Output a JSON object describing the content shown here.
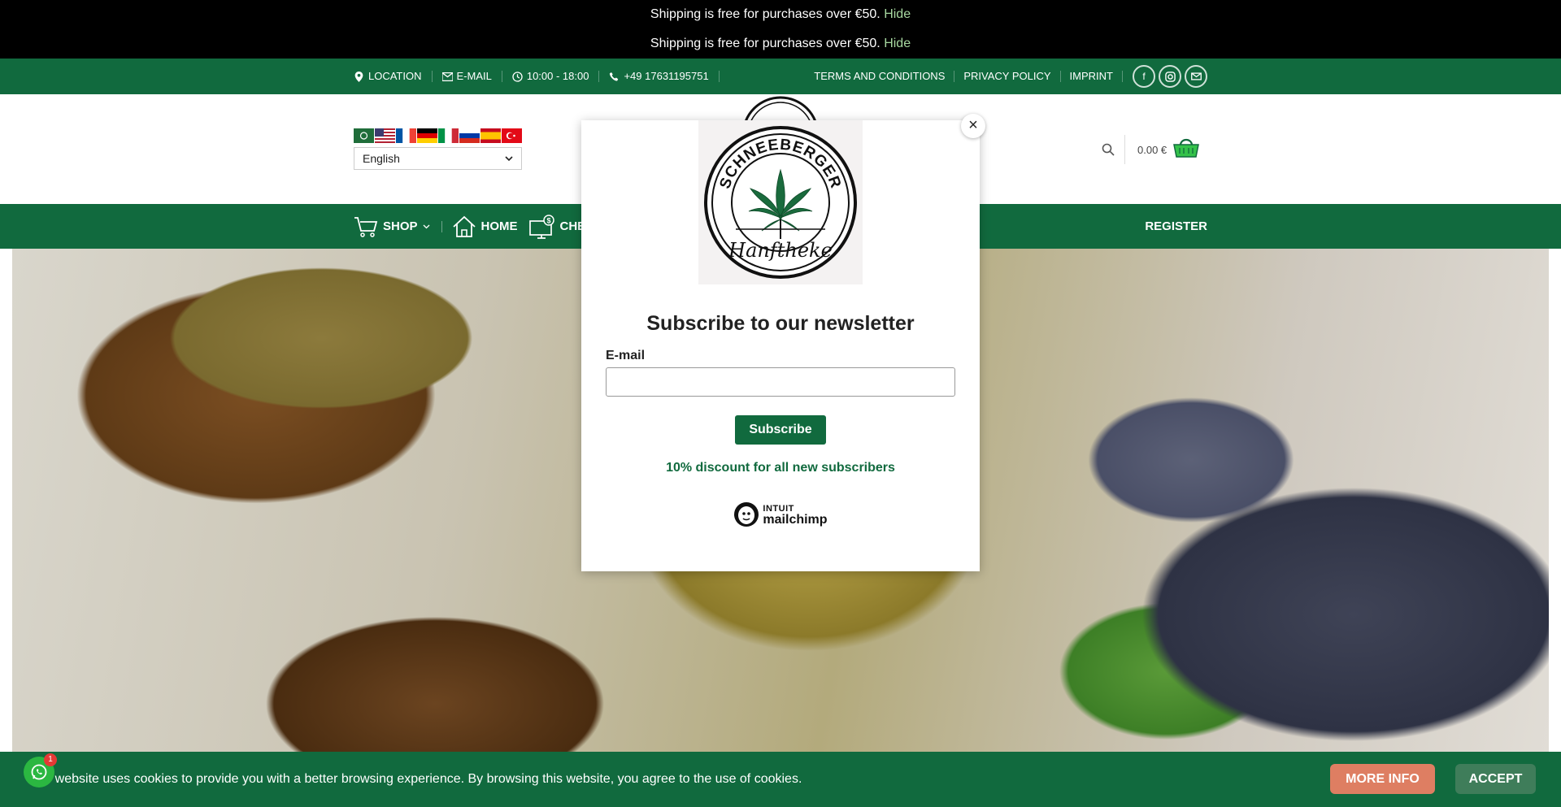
{
  "promo": {
    "lines": [
      {
        "text": "Shipping is free for purchases over €50.",
        "link": "Hide"
      },
      {
        "text": "Shipping is free for purchases over €50.",
        "link": "Hide"
      }
    ]
  },
  "topbar": {
    "location": "LOCATION",
    "email": "E-MAIL",
    "hours": "10:00 - 18:00",
    "phone": "+49 17631195751",
    "links": [
      "TERMS AND CONDITIONS",
      "PRIVACY POLICY",
      "IMPRINT"
    ],
    "social": [
      "facebook-icon",
      "instagram-icon",
      "mail-icon"
    ]
  },
  "header": {
    "language_selected": "English",
    "flags": [
      "ar",
      "en",
      "fr",
      "de",
      "it",
      "ru",
      "es",
      "tr"
    ],
    "cart_total": "0.00 €"
  },
  "nav": {
    "shop": "SHOP",
    "home": "HOME",
    "check": "CHE",
    "register": "REGISTER"
  },
  "modal": {
    "logo_text": "SCHNEEBERGER",
    "logo_script": "Hanftheke",
    "title": "Subscribe to our newsletter",
    "email_label": "E-mail",
    "email_value": "",
    "subscribe_label": "Subscribe",
    "discount": "10% discount for all new subscribers",
    "badge_brand": "INTUIT",
    "badge_name": "mailchimp",
    "close_symbol": "×"
  },
  "cookie": {
    "text": "This website uses cookies to provide you with a better browsing experience. By browsing this website, you agree to the use of cookies.",
    "more_info": "MORE INFO",
    "accept": "ACCEPT"
  },
  "whatsapp": {
    "badge": "1"
  },
  "colors": {
    "brand_green": "#116a3e",
    "more_info": "#de7e62",
    "accept": "#3f7d5a",
    "promo_link": "#a7d8a0"
  }
}
